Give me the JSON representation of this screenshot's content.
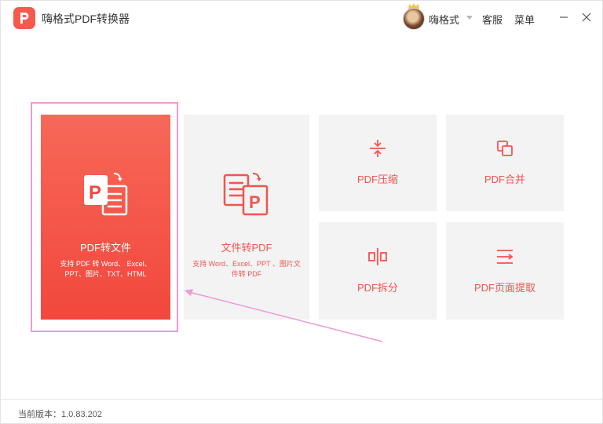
{
  "app": {
    "title": "嗨格式PDF转换器",
    "brand_color": "#f55a4e"
  },
  "header": {
    "username": "嗨格式",
    "service_label": "客服",
    "menu_label": "菜单",
    "minimize_icon": "minimize-icon",
    "close_icon": "close-icon"
  },
  "tiles": {
    "pdf_to_file": {
      "label": "PDF转文件",
      "desc_line1": "支持 PDF 转 Word、 Excel、",
      "desc_line2": "PPT、图片、TXT、HTML"
    },
    "file_to_pdf": {
      "label": "文件转PDF",
      "desc_line1": "支持 Word、Excel、PPT 、图片文",
      "desc_line2": "件转 PDF"
    },
    "compress": {
      "label": "PDF压缩"
    },
    "merge": {
      "label": "PDF合并"
    },
    "split": {
      "label": "PDF拆分"
    },
    "extract": {
      "label": "PDF页面提取"
    }
  },
  "status": {
    "version": "当前版本：1.0.83.202"
  },
  "colors": {
    "accent": "#f05550",
    "highlight": "#ee9ad5",
    "tile_bg": "#f3f3f3"
  }
}
